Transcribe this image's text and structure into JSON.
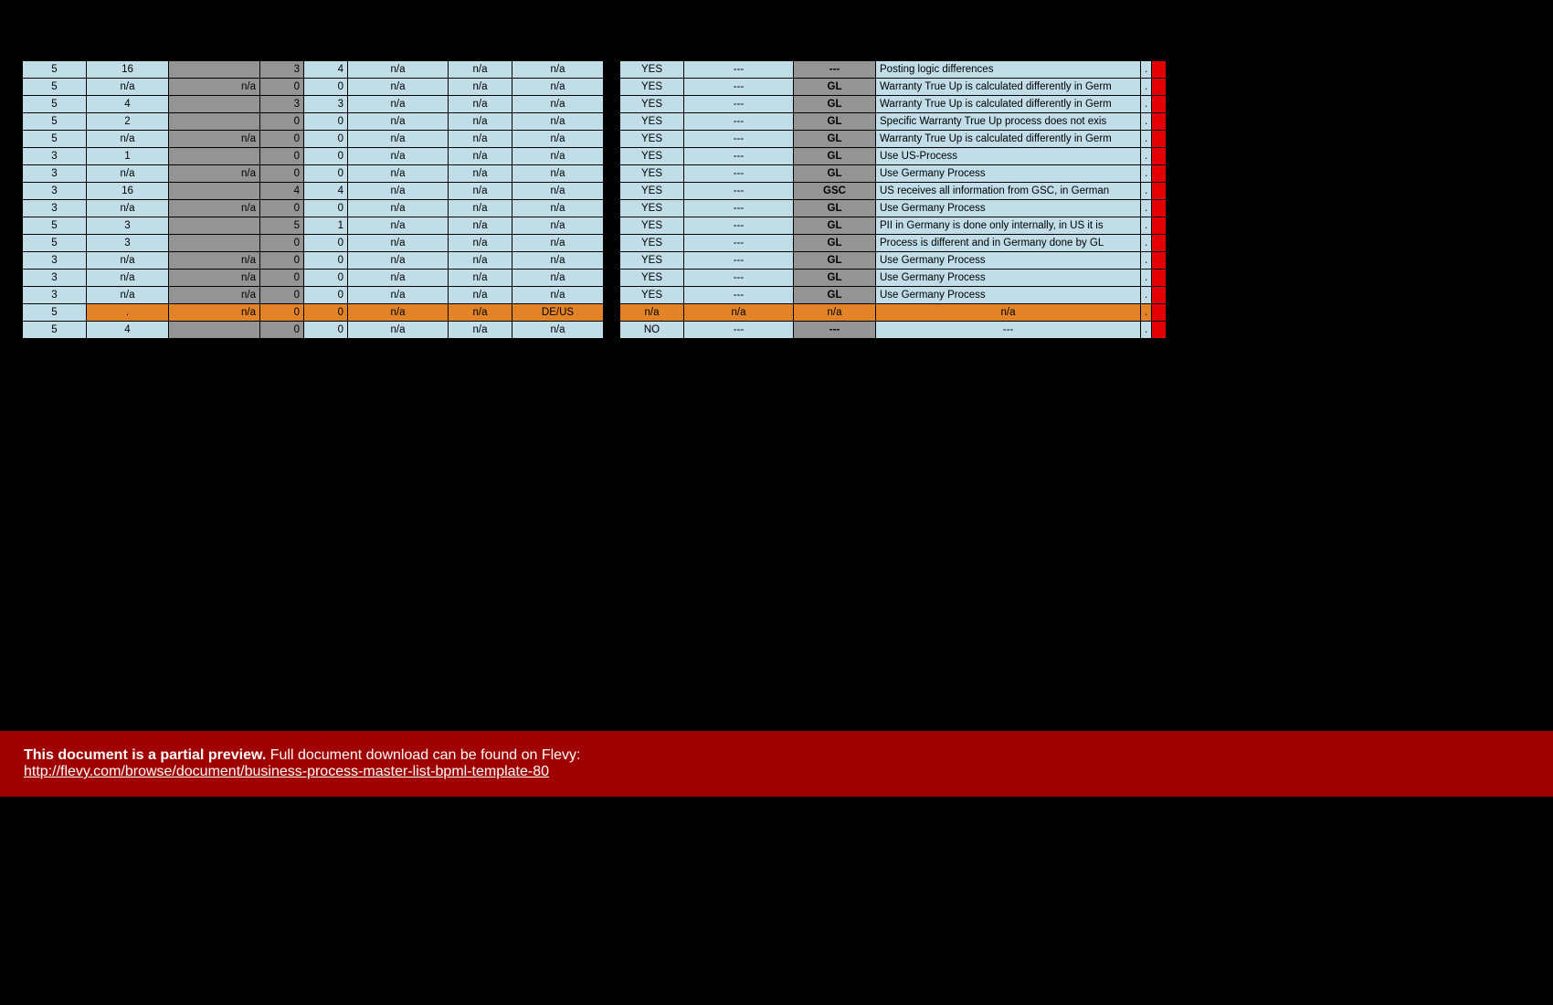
{
  "rows": [
    {
      "c0": "5",
      "c1": "16",
      "c2": "",
      "c3": "3",
      "c4": "4",
      "c5": "n/a",
      "c6": "n/a",
      "c7": "n/a",
      "c8": "YES",
      "c9": "---",
      "c10": "---",
      "c10cls": "grey",
      "desc": "Posting logic differences",
      "clip": "."
    },
    {
      "c0": "5",
      "c1": "n/a",
      "c2": "n/a",
      "c2cls": "grey",
      "c3": "0",
      "c4": "0",
      "c5": "n/a",
      "c6": "n/a",
      "c7": "n/a",
      "c8": "YES",
      "c9": "---",
      "c10": "GL",
      "desc": "Warranty True Up is calculated differently in Germ",
      "clip": "."
    },
    {
      "c0": "5",
      "c1": "4",
      "c2": "",
      "c3": "3",
      "c4": "3",
      "c5": "n/a",
      "c6": "n/a",
      "c7": "n/a",
      "c8": "YES",
      "c9": "---",
      "c10": "GL",
      "desc": "Warranty True Up is calculated differently in Germ",
      "clip": "."
    },
    {
      "c0": "5",
      "c1": "2",
      "c2": "",
      "c3": "0",
      "c4": "0",
      "c5": "n/a",
      "c6": "n/a",
      "c7": "n/a",
      "c8": "YES",
      "c9": "---",
      "c10": "GL",
      "desc": "Specific Warranty True Up process does not exis",
      "clip": "."
    },
    {
      "c0": "5",
      "c1": "n/a",
      "c2": "n/a",
      "c2cls": "grey",
      "c3": "0",
      "c4": "0",
      "c5": "n/a",
      "c6": "n/a",
      "c7": "n/a",
      "c8": "YES",
      "c9": "---",
      "c10": "GL",
      "desc": "Warranty True Up is calculated differently in Germ",
      "clip": "."
    },
    {
      "c0": "3",
      "c1": "1",
      "c2": "",
      "c3": "0",
      "c4": "0",
      "c5": "n/a",
      "c6": "n/a",
      "c7": "n/a",
      "c8": "YES",
      "c9": "---",
      "c10": "GL",
      "desc": "Use US-Process",
      "clip": "."
    },
    {
      "c0": "3",
      "c1": "n/a",
      "c2": "n/a",
      "c2cls": "grey",
      "c3": "0",
      "c4": "0",
      "c5": "n/a",
      "c6": "n/a",
      "c7": "n/a",
      "c8": "YES",
      "c9": "---",
      "c10": "GL",
      "desc": "Use Germany Process",
      "clip": "."
    },
    {
      "c0": "3",
      "c1": "16",
      "c2": "",
      "c3": "4",
      "c4": "4",
      "c5": "n/a",
      "c6": "n/a",
      "c7": "n/a",
      "c8": "YES",
      "c9": "---",
      "c10": "GSC",
      "desc": "US receives all information from GSC, in German",
      "clip": "."
    },
    {
      "c0": "3",
      "c1": "n/a",
      "c2": "n/a",
      "c2cls": "grey",
      "c3": "0",
      "c4": "0",
      "c5": "n/a",
      "c6": "n/a",
      "c7": "n/a",
      "c8": "YES",
      "c9": "---",
      "c10": "GL",
      "desc": "Use Germany Process",
      "clip": "."
    },
    {
      "c0": "5",
      "c1": "3",
      "c2": "",
      "c3": "5",
      "c4": "1",
      "c5": "n/a",
      "c6": "n/a",
      "c7": "n/a",
      "c8": "YES",
      "c9": "---",
      "c10": "GL",
      "desc": "PII in Germany is done only internally, in US it is",
      "clip": "."
    },
    {
      "c0": "5",
      "c1": "3",
      "c2": "",
      "c3": "0",
      "c4": "0",
      "c5": "n/a",
      "c6": "n/a",
      "c7": "n/a",
      "c8": "YES",
      "c9": "---",
      "c10": "GL",
      "desc": "Process is different and in Germany done by GL",
      "clip": "."
    },
    {
      "c0": "3",
      "c1": "n/a",
      "c2": "n/a",
      "c2cls": "grey",
      "c3": "0",
      "c4": "0",
      "c5": "n/a",
      "c6": "n/a",
      "c7": "n/a",
      "c8": "YES",
      "c9": "---",
      "c10": "GL",
      "desc": "Use Germany Process",
      "clip": "."
    },
    {
      "c0": "3",
      "c1": "n/a",
      "c2": "n/a",
      "c2cls": "grey",
      "c3": "0",
      "c4": "0",
      "c5": "n/a",
      "c6": "n/a",
      "c7": "n/a",
      "c8": "YES",
      "c9": "---",
      "c10": "GL",
      "desc": "Use Germany Process",
      "clip": "."
    },
    {
      "c0": "3",
      "c1": "n/a",
      "c2": "n/a",
      "c2cls": "grey",
      "c3": "0",
      "c4": "0",
      "c5": "n/a",
      "c6": "n/a",
      "c7": "n/a",
      "c8": "YES",
      "c9": "---",
      "c10": "GL",
      "desc": "Use Germany Process",
      "clip": "."
    },
    {
      "cls": "orange",
      "c0": "5",
      "c0cls": "blue",
      "c1": ".",
      "c2": "n/a",
      "c3": "0",
      "c4": "0",
      "c5": "n/a",
      "c6": "n/a",
      "c7": "DE/US",
      "c8": "n/a",
      "c9": "n/a",
      "c10": "n/a",
      "c10cls": "orange",
      "c10nob": true,
      "desc": "n/a",
      "desccls": "orange",
      "descalign": "center",
      "clip": "."
    },
    {
      "c0": "5",
      "c1": "4",
      "c2": "",
      "c3": "0",
      "c4": "0",
      "c5": "n/a",
      "c6": "n/a",
      "c7": "n/a",
      "c8": "NO",
      "c9": "---",
      "c10": "---",
      "c10cls": "grey",
      "desc": "---",
      "descalign": "center",
      "clip": "."
    }
  ],
  "banner": {
    "bold": "This document is a partial preview.",
    "text": "Full document download can be found on Flevy:",
    "link": "http://flevy.com/browse/document/business-process-master-list-bpml-template-80"
  }
}
